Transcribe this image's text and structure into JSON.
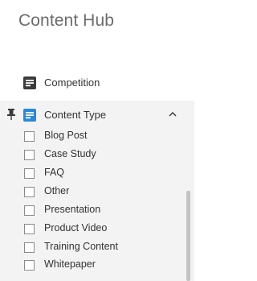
{
  "header": {
    "title": "Content Hub"
  },
  "nav": {
    "competition": {
      "label": "Competition",
      "icon": "document-icon",
      "icon_color": "#3c3c3c"
    },
    "content_type": {
      "label": "Content Type",
      "icon": "document-icon",
      "icon_color": "#2b88d8",
      "pin_icon": "pin-icon",
      "expand_icon": "chevron-up-icon",
      "expanded": true,
      "options": [
        {
          "label": "Blog Post",
          "checked": false
        },
        {
          "label": "Case Study",
          "checked": false
        },
        {
          "label": "FAQ",
          "checked": false
        },
        {
          "label": "Other",
          "checked": false
        },
        {
          "label": "Presentation",
          "checked": false
        },
        {
          "label": "Product Video",
          "checked": false
        },
        {
          "label": "Training Content",
          "checked": false
        },
        {
          "label": "Whitepaper",
          "checked": false
        }
      ]
    }
  },
  "colors": {
    "section_background": "#f3f3f3",
    "accent": "#2b88d8",
    "title": "#6b6b6b"
  }
}
